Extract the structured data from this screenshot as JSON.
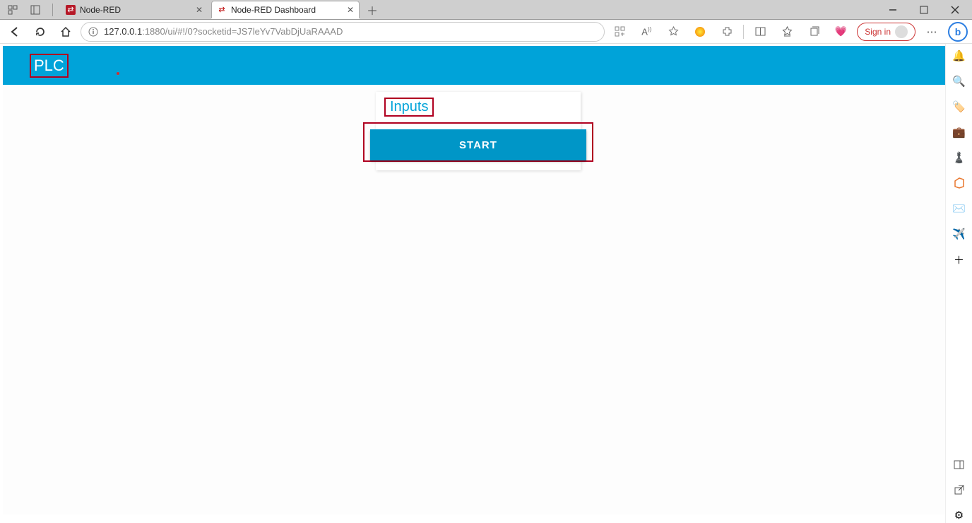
{
  "browser": {
    "tabs": [
      {
        "title": "Node-RED"
      },
      {
        "title": "Node-RED Dashboard"
      }
    ],
    "url_host": "127.0.0.1",
    "url_port_path": ":1880/ui/#!/0?socketid=JS7leYv7VabDjUaRAAAD",
    "signin_label": "Sign in"
  },
  "dashboard": {
    "header_title": "PLC",
    "card_title": "Inputs",
    "start_button_label": "START"
  }
}
